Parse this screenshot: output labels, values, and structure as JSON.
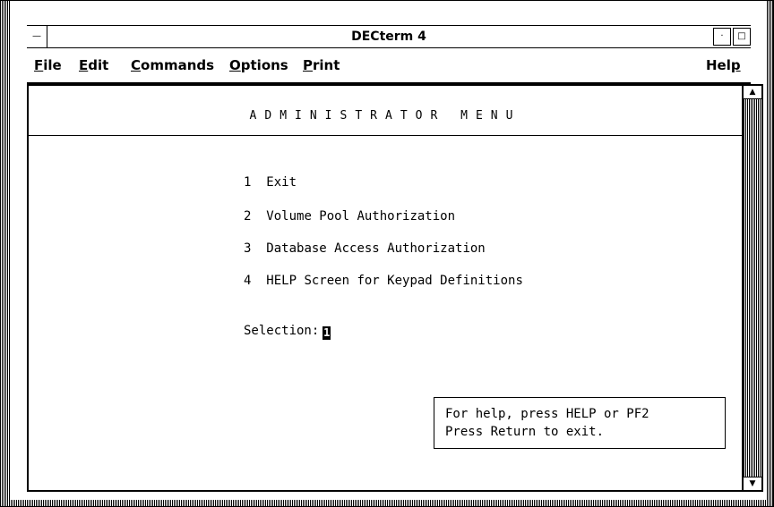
{
  "window": {
    "title": "DECterm 4",
    "window_menu_glyph": "—",
    "minimize_glyph": "·",
    "maximize_glyph": "□"
  },
  "menubar": {
    "items": [
      {
        "label": "File",
        "mnemonic": "F",
        "rest": "ile"
      },
      {
        "label": "Edit",
        "mnemonic": "E",
        "rest": "dit"
      },
      {
        "label": "Commands",
        "mnemonic": "C",
        "rest": "ommands"
      },
      {
        "label": "Options",
        "mnemonic": "O",
        "rest": "ptions"
      },
      {
        "label": "Print",
        "mnemonic": "P",
        "rest": "rint"
      }
    ],
    "help": {
      "label": "Help",
      "mnemonic": "p",
      "pre": "Hel"
    }
  },
  "screen": {
    "title": "ADMINISTRATOR MENU",
    "options": [
      {
        "number": "1",
        "label": "Exit"
      },
      {
        "number": "2",
        "label": "Volume Pool Authorization"
      },
      {
        "number": "3",
        "label": "Database Access Authorization"
      },
      {
        "number": "4",
        "label": "HELP Screen for Keypad Definitions"
      }
    ],
    "selection_label": "Selection:",
    "selection_value": "1",
    "help_lines": [
      "For help, press HELP or PF2",
      "Press Return to exit."
    ]
  }
}
